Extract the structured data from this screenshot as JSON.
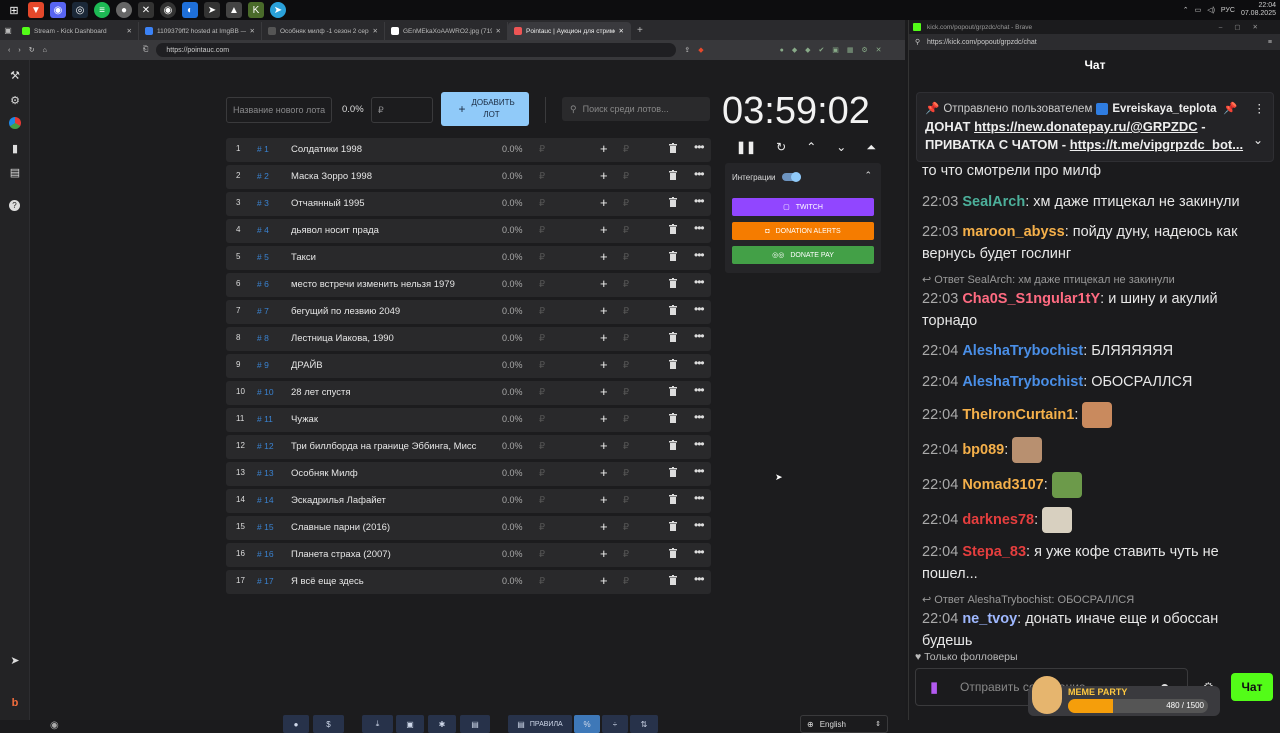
{
  "taskbar": {
    "lang": "РУС",
    "time": "22:04",
    "date": "07.08.2025"
  },
  "left_browser": {
    "tabs": [
      {
        "label": "Stream - Kick Dashboard",
        "color": "#53fc18"
      },
      {
        "label": "1109379ff2 hosted at ImgBB — Img...",
        "color": "#3b82f6"
      },
      {
        "label": "Особняк милф -1 сезон 2 серия / ...",
        "color": "#555"
      },
      {
        "label": "GEnMEkaXoAAWRO2.jpg (719×676)",
        "color": "#fff"
      },
      {
        "label": "Pointauc | Аукцион для стриме...",
        "color": "#e55",
        "active": true
      }
    ],
    "url": "https://pointauc.com"
  },
  "controls": {
    "new_lot_placeholder": "Название нового лота",
    "percent": "0.0%",
    "currency_placeholder": "₽",
    "add_lot_label": "Добавить лот",
    "search_placeholder": "Поиск среди лотов..."
  },
  "lots": [
    {
      "idx": "1",
      "tag": "# 1",
      "name": "Солдатики 1998",
      "pct": "0.0%"
    },
    {
      "idx": "2",
      "tag": "# 2",
      "name": "Маска Зорро 1998",
      "pct": "0.0%"
    },
    {
      "idx": "3",
      "tag": "# 3",
      "name": "Отчаянный 1995",
      "pct": "0.0%"
    },
    {
      "idx": "4",
      "tag": "# 4",
      "name": "дьявол носит прада",
      "pct": "0.0%"
    },
    {
      "idx": "5",
      "tag": "# 5",
      "name": "Такси",
      "pct": "0.0%"
    },
    {
      "idx": "6",
      "tag": "# 6",
      "name": "место встречи изменить нельзя 1979",
      "pct": "0.0%"
    },
    {
      "idx": "7",
      "tag": "# 7",
      "name": "бегущий по лезвию 2049",
      "pct": "0.0%"
    },
    {
      "idx": "8",
      "tag": "# 8",
      "name": "Лестница Иакова, 1990",
      "pct": "0.0%"
    },
    {
      "idx": "9",
      "tag": "# 9",
      "name": "ДРАЙВ",
      "pct": "0.0%"
    },
    {
      "idx": "10",
      "tag": "# 10",
      "name": "28 лет спустя",
      "pct": "0.0%"
    },
    {
      "idx": "11",
      "tag": "# 11",
      "name": "Чужак",
      "pct": "0.0%"
    },
    {
      "idx": "12",
      "tag": "# 12",
      "name": "Три биллборда на границе Эббинга, Мисс",
      "pct": "0.0%"
    },
    {
      "idx": "13",
      "tag": "# 13",
      "name": "Особняк Милф",
      "pct": "0.0%"
    },
    {
      "idx": "14",
      "tag": "# 14",
      "name": "Эскадрилья Лафайет",
      "pct": "0.0%"
    },
    {
      "idx": "15",
      "tag": "# 15",
      "name": "Славные парни (2016)",
      "pct": "0.0%"
    },
    {
      "idx": "16",
      "tag": "# 16",
      "name": "Планета страха (2007)",
      "pct": "0.0%"
    },
    {
      "idx": "17",
      "tag": "# 17",
      "name": "Я всё еще здесь",
      "pct": "0.0%"
    }
  ],
  "currency_symbol": "₽",
  "timer": "03:59:02",
  "integrations": {
    "label": "Интеграции",
    "twitch": "Twitch",
    "donation_alerts": "Donation Alerts",
    "donate_pay": "Donate Pay",
    "colors": {
      "twitch": "#9146ff",
      "donation_alerts": "#f57c00",
      "donate_pay": "#43a047"
    }
  },
  "bottom": {
    "rules": "Правила",
    "language": "English"
  },
  "right_browser": {
    "title": "kick.com/popout/grpzdc/chat - Brave",
    "url": "https://kick.com/popout/grpzdc/chat"
  },
  "chat": {
    "header": "Чат",
    "pinned_prefix": "Отправлено пользователем",
    "pinned_user": "Evreiskaya_teplota",
    "pinned_text_1": "ДОНАТ",
    "pinned_link_1": "https://new.donatepay.ru/@GRPZDC",
    "pinned_text_2": "- ПРИВАТКА С ЧАТОМ -",
    "pinned_link_2": "https://t.me/vipgrpzdc_bot...",
    "messages": [
      {
        "time": "",
        "user": "",
        "color": "#fff",
        "text": "то что смотрели про милф"
      },
      {
        "time": "22:03",
        "user": "SealArch",
        "color": "#4caf9a",
        "text": ": хм даже птицекал не закинули"
      },
      {
        "time": "22:03",
        "user": "maroon_abyss",
        "color": "#f5b04a",
        "text": ": пойду дуну, надеюсь как вернусь будет гослинг"
      },
      {
        "reply": "Ответ SealArch: хм даже птицекал не закинули",
        "time": "22:03",
        "user": "Cha0S_S1ngular1tY",
        "color": "#ff6b81",
        "text": ": и шину и акулий торнадо"
      },
      {
        "time": "22:04",
        "user": "AleshaTrybochist",
        "color": "#4a8fe7",
        "text": ": БЛЯЯЯЯЯЯ"
      },
      {
        "time": "22:04",
        "user": "AleshaTrybochist",
        "color": "#4a8fe7",
        "text": ": ОБОСРАЛЛСЯ"
      },
      {
        "time": "22:04",
        "user": "TheIronCurtain1",
        "color": "#f5b04a",
        "text": ":",
        "emote": "#c98a5e"
      },
      {
        "time": "22:04",
        "user": "bp089",
        "color": "#f5b04a",
        "text": ":",
        "emote": "#b89070"
      },
      {
        "time": "22:04",
        "user": "Nomad3107",
        "color": "#f5b04a",
        "text": ":",
        "emote": "#6c9a4a"
      },
      {
        "time": "22:04",
        "user": "darknes78",
        "color": "#e53e3e",
        "text": ":",
        "emote": "#d8d0c0"
      },
      {
        "time": "22:04",
        "user": "Stepa_83",
        "color": "#e53e3e",
        "text": ": я уже кофе ставить чуть не пошел..."
      },
      {
        "reply": "Ответ AleshaTrybochist: ОБОСРАЛЛСЯ",
        "time": "22:04",
        "user": "ne_tvoy",
        "color": "#9fb8ff",
        "text": ": донать иначе еще и обоссан будешь"
      }
    ],
    "followers_only": "Только фолловеры",
    "input_placeholder": "Отправить сообщение",
    "send_label": "Чат",
    "meme_party_title": "MEME PARTY",
    "meme_party_count": "480 / 1500"
  }
}
